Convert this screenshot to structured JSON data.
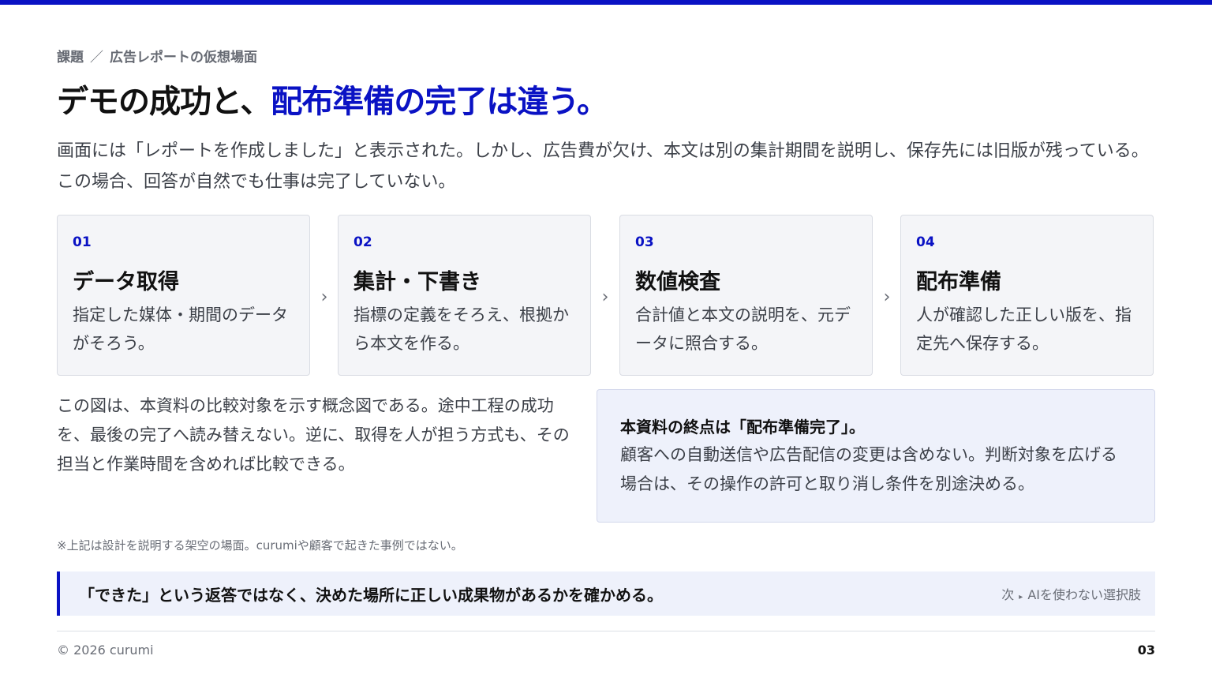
{
  "breadcrumb": {
    "section": "課題",
    "separator": "／",
    "topic": "広告レポートの仮想場面"
  },
  "title": {
    "plain": "デモの成功と、",
    "accent": "配布準備の完了は違う。"
  },
  "lead": "画面には「レポートを作成しました」と表示された。しかし、広告費が欠け、本文は別の集計期間を説明し、保存先には旧版が残っている。この場合、回答が自然でも仕事は完了していない。",
  "steps": [
    {
      "num": "01",
      "title": "データ取得",
      "desc": "指定した媒体・期間のデータがそろう。"
    },
    {
      "num": "02",
      "title": "集計・下書き",
      "desc": "指標の定義をそろえ、根拠から本文を作る。"
    },
    {
      "num": "03",
      "title": "数値検査",
      "desc": "合計値と本文の説明を、元データに照合する。"
    },
    {
      "num": "04",
      "title": "配布準備",
      "desc": "人が確認した正しい版を、指定先へ保存する。"
    }
  ],
  "arrow_glyph": "›",
  "note_left": "この図は、本資料の比較対象を示す概念図である。途中工程の成功を、最後の完了へ読み替えない。逆に、取得を人が担う方式も、その担当と作業時間を含めれば比較できる。",
  "callout": {
    "title": "本資料の終点は「配布準備完了」。",
    "body": "顧客への自動送信や広告配信の変更は含めない。判断対象を広げる場合は、その操作の許可と取り消し条件を別途決める。"
  },
  "footnote": "※上記は設計を説明する架空の場面。curumiや顧客で起きた事例ではない。",
  "banner": {
    "message": "「できた」という返答ではなく、決めた場所に正しい成果物があるかを確かめる。",
    "next_prefix": "次",
    "next_arrow": "▸",
    "next_label": "AIを使わない選択肢"
  },
  "footer": {
    "copyright": "© 2026 curumi",
    "page": "03"
  },
  "colors": {
    "accent": "#0a12c4",
    "card_bg": "#f4f5f8",
    "callout_bg": "#eef1fb"
  }
}
